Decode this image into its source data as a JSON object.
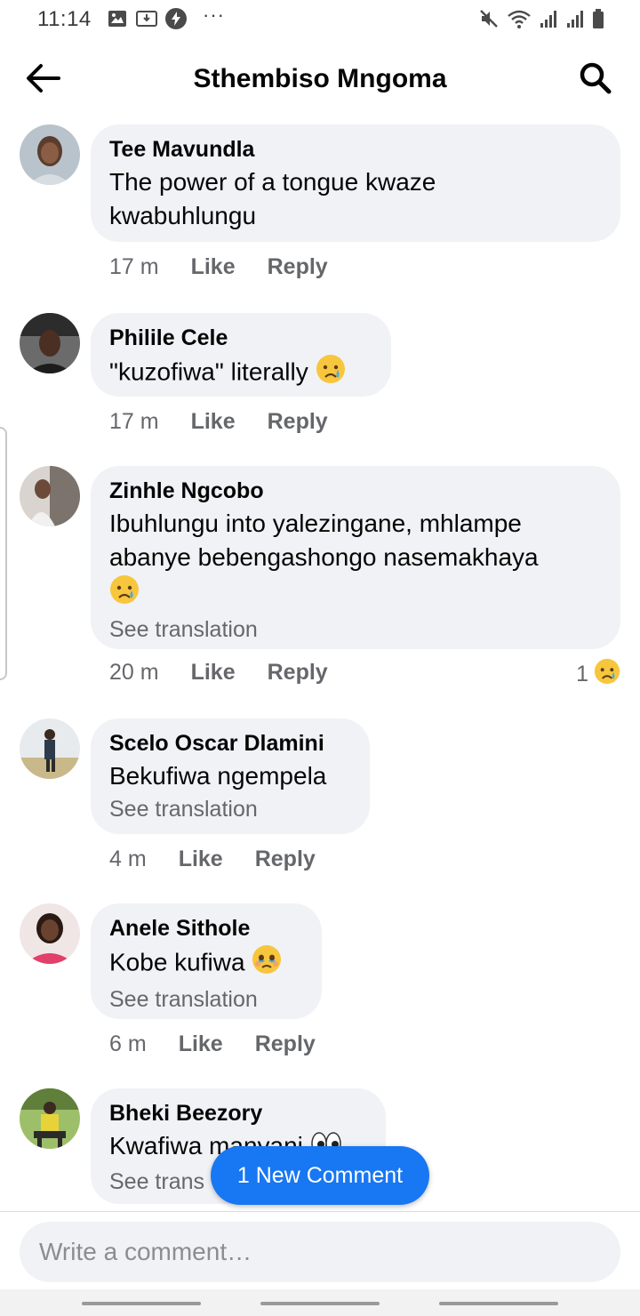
{
  "status_bar": {
    "time": "11:14",
    "icons": [
      "gallery-icon",
      "screen-recorder-icon",
      "bolt-icon",
      "more-dots-icon",
      "mute-icon",
      "wifi-icon",
      "signal-icon",
      "signal-icon",
      "battery-icon"
    ],
    "dots": "···"
  },
  "header": {
    "title": "Sthembiso Mngoma",
    "back_icon": "back-arrow-icon",
    "search_icon": "search-icon"
  },
  "comments": [
    {
      "name": "Tee Mavundla",
      "text_lines": [
        "The power of a tongue kwaze",
        "kwabuhlungu"
      ],
      "time": "17 m",
      "like": "Like",
      "reply": "Reply"
    },
    {
      "name": "Philile Cele",
      "text_lines": [
        "\"kuzofiwa\" literally"
      ],
      "emoji": "crying-face",
      "time": "17 m",
      "like": "Like",
      "reply": "Reply"
    },
    {
      "name": "Zinhle Ngcobo",
      "text_lines": [
        "Ibuhlungu into yalezingane, mhlampe",
        "abanye bebengashongo nasemakhaya"
      ],
      "emoji": "crying-face",
      "see_translation": "See translation",
      "time": "20 m",
      "like": "Like",
      "reply": "Reply",
      "reaction_count": "1",
      "reaction_emoji": "crying-face"
    },
    {
      "name": "Scelo Oscar Dlamini",
      "text_lines": [
        "Bekufiwa ngempela"
      ],
      "see_translation": "See translation",
      "time": "4 m",
      "like": "Like",
      "reply": "Reply"
    },
    {
      "name": "Anele Sithole",
      "text_lines": [
        "Kobe kufiwa"
      ],
      "emoji": "holding-back-tears-face",
      "see_translation": "See translation",
      "time": "6 m",
      "like": "Like",
      "reply": "Reply"
    },
    {
      "name": "Bheki Beezory",
      "text_lines": [
        "Kwafiwa manyani"
      ],
      "emoji": "eyes",
      "see_translation": "See trans"
    }
  ],
  "new_comment_pill": "1 New Comment",
  "composer": {
    "placeholder": "Write a comment…"
  },
  "colors": {
    "accent": "#1877f2",
    "bubble": "#f0f2f5",
    "secondary_text": "#65676b"
  }
}
